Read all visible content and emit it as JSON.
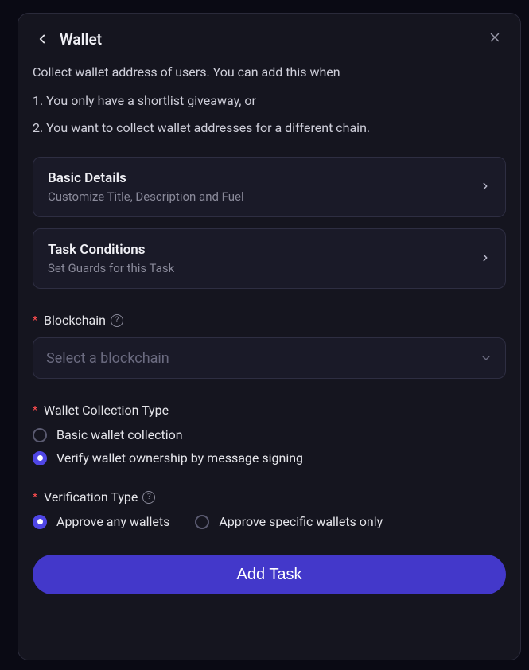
{
  "header": {
    "title": "Wallet"
  },
  "intro": {
    "description": "Collect wallet address of users. You can add this when",
    "point1": "1. You only have a shortlist giveaway, or",
    "point2": "2. You want to collect wallet addresses for a different chain."
  },
  "cards": {
    "basic": {
      "title": "Basic Details",
      "subtitle": "Customize Title, Description and Fuel"
    },
    "conditions": {
      "title": "Task Conditions",
      "subtitle": "Set Guards for this Task"
    }
  },
  "fields": {
    "blockchain": {
      "label": "Blockchain",
      "placeholder": "Select a blockchain"
    },
    "collection_type": {
      "label": "Wallet Collection Type",
      "option_basic": "Basic wallet collection",
      "option_verify": "Verify wallet ownership by message signing"
    },
    "verification_type": {
      "label": "Verification Type",
      "option_any": "Approve any wallets",
      "option_specific": "Approve specific wallets only"
    }
  },
  "buttons": {
    "submit": "Add Task"
  },
  "state": {
    "collection_selected": "verify",
    "verification_selected": "any"
  }
}
